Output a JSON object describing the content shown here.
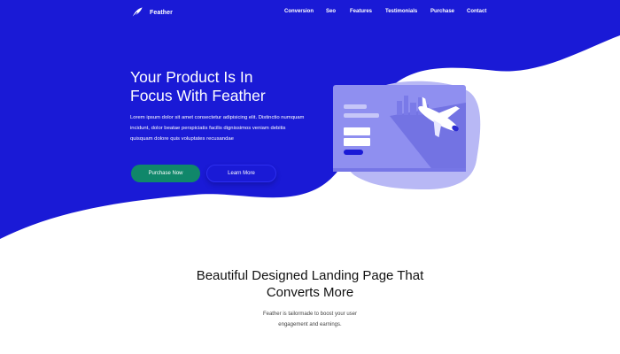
{
  "brand": {
    "name": "Feather",
    "icon": "feather-icon"
  },
  "nav": {
    "items": [
      {
        "label": "Conversion"
      },
      {
        "label": "Seo"
      },
      {
        "label": "Features"
      },
      {
        "label": "Testimonials"
      },
      {
        "label": "Purchase"
      },
      {
        "label": "Contact"
      }
    ]
  },
  "hero": {
    "title_line1": "Your Product Is In",
    "title_line2": "Focus With Feather",
    "body": "Lorem ipsum dolor sit amet consectetur adipisicing elit. Distinctio numquam incidunt, dolor beatae perspiciatis facilis dignissimos veniam debitis quisquam dolore quis voluptates recusandae",
    "primary_button": "Purchase Now",
    "secondary_button": "Learn More",
    "illustration_icon": "airplane-card-illustration"
  },
  "section": {
    "title_line1": "Beautiful Designed Landing Page That",
    "title_line2": "Converts More",
    "sub_line1": "Feather is tailormade to boost your user",
    "sub_line2": "engagement and earnings."
  },
  "colors": {
    "hero_blue": "#1a1ad6",
    "button_green": "#10876a",
    "card_purple": "#8f8ff0",
    "white": "#ffffff"
  }
}
